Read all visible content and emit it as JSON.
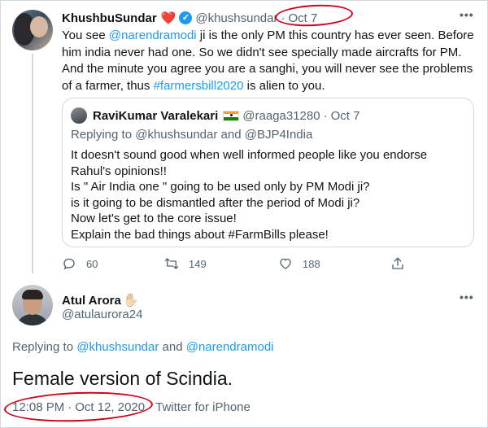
{
  "tweet1": {
    "author_name": "KhushbuSundar",
    "heart_emoji": "❤️",
    "verified_icon": "verified-badge-icon",
    "handle": "@khushsundar",
    "separator": "·",
    "date": "Oct 7",
    "more_icon": "more-options-icon",
    "body": {
      "line1_pre": "You see ",
      "mention": "@narendramodi",
      "line1_post": " ji is the only PM this country has ever seen. Before",
      "line2": "him india never had one. So we didn't see specially made aircrafts for PM.",
      "line3": "And the minute you agree you are a sanghi, you will never see the problems",
      "line4_pre": "of a farmer, thus ",
      "hashtag": "#farmersbill2020",
      "line4_post": " is alien to you."
    },
    "quote": {
      "author_name": "RaviKumar Varalekari",
      "flag_icon": "india-flag-icon",
      "handle": "@raaga31280",
      "separator": "·",
      "date": "Oct 7",
      "replying_prefix": "Replying to ",
      "replying_user1": "@khushsundar",
      "replying_and": " and ",
      "replying_user2": "@BJP4India",
      "lines": [
        "It doesn't sound good when well informed people like you endorse",
        "Rahul's opinions!!",
        "Is \" Air India one \" going to be used only by PM Modi ji?",
        "is it going to be dismantled after the period of Modi ji?",
        "Now let's get to the core issue!",
        "Explain the bad things about #FarmBills please!"
      ]
    },
    "actions": {
      "reply_count": "60",
      "retweet_count": "149",
      "like_count": "188"
    }
  },
  "tweet2": {
    "author_name": "Atul Arora",
    "hand_emoji": "✋🏻",
    "handle": "@atulaurora24",
    "more_icon": "more-options-icon",
    "replying_prefix": "Replying to ",
    "replying_user1": "@khushsundar",
    "replying_and": " and ",
    "replying_user2": "@narendramodi",
    "body": "Female version of Scindia.",
    "time": "12:08 PM",
    "separator": "·",
    "date": "Oct 12, 2020",
    "separator2": "·",
    "source": "Twitter for iPhone"
  },
  "colors": {
    "link": "#1d9bf0",
    "secondary_text": "#536471",
    "annotation_red": "#d0021b",
    "heart": "#e0245e"
  }
}
